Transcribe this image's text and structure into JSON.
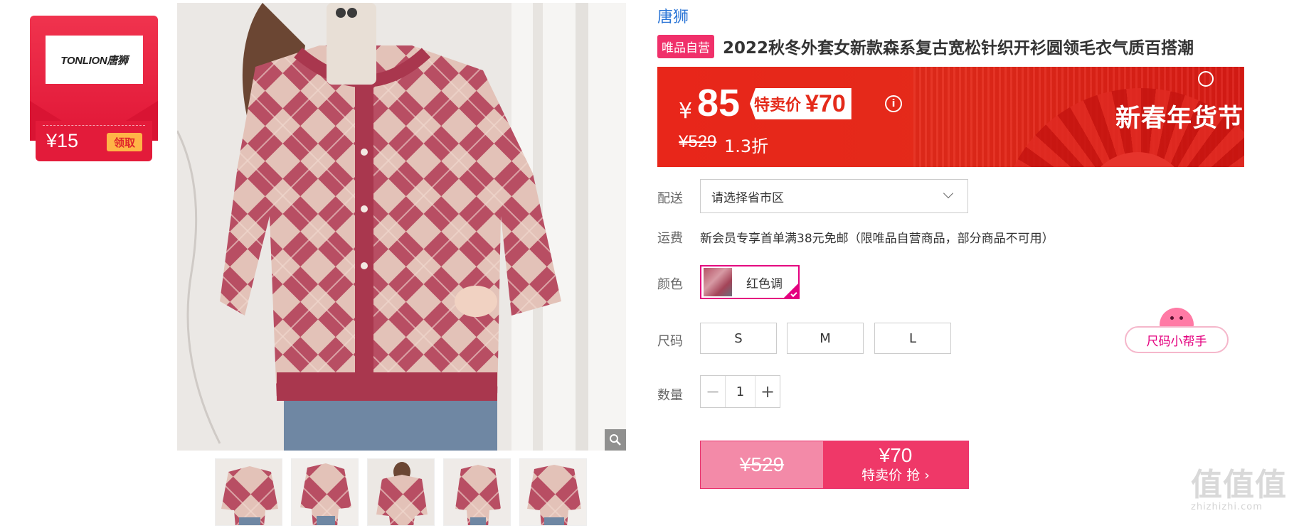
{
  "coupon": {
    "logo_text": "TONLION唐狮",
    "amount": "¥15",
    "claim_label": "领取",
    "color": "#e31b3a"
  },
  "gallery": {
    "zoom_icon": "magnifier-icon",
    "thumbnail_count": 5
  },
  "product": {
    "brand": "唐狮",
    "self_operated_tag": "唯品自营",
    "title": "2022秋冬外套女新款森系复古宽松针织开衫圆领毛衣气质百搭潮"
  },
  "price": {
    "currency": "¥",
    "current": "85",
    "special_label": "特卖价",
    "special_price": "¥70",
    "list_price": "¥529",
    "discount": "1.3折",
    "festival_label": "新春年货节",
    "info_icon": "info-icon",
    "banner_color": "#e42a1a"
  },
  "delivery": {
    "label": "配送",
    "placeholder": "请选择省市区"
  },
  "shipping": {
    "label": "运费",
    "text": "新会员专享首单满38元免邮（限唯品自营商品，部分商品不可用）"
  },
  "color": {
    "label": "颜色",
    "selected": "红色调",
    "accent": "#e4007f"
  },
  "size": {
    "label": "尺码",
    "options": [
      "S",
      "M",
      "L"
    ],
    "helper_label": "尺码小帮手"
  },
  "quantity": {
    "label": "数量",
    "value": "1",
    "minus": "−",
    "plus": "+"
  },
  "buy": {
    "original_price": "¥529",
    "price": "¥70",
    "label": "特卖价 抢 ›",
    "color": "#ef3868"
  },
  "watermark": {
    "mark": "值值值",
    "site": "zhizhizhi.com"
  }
}
